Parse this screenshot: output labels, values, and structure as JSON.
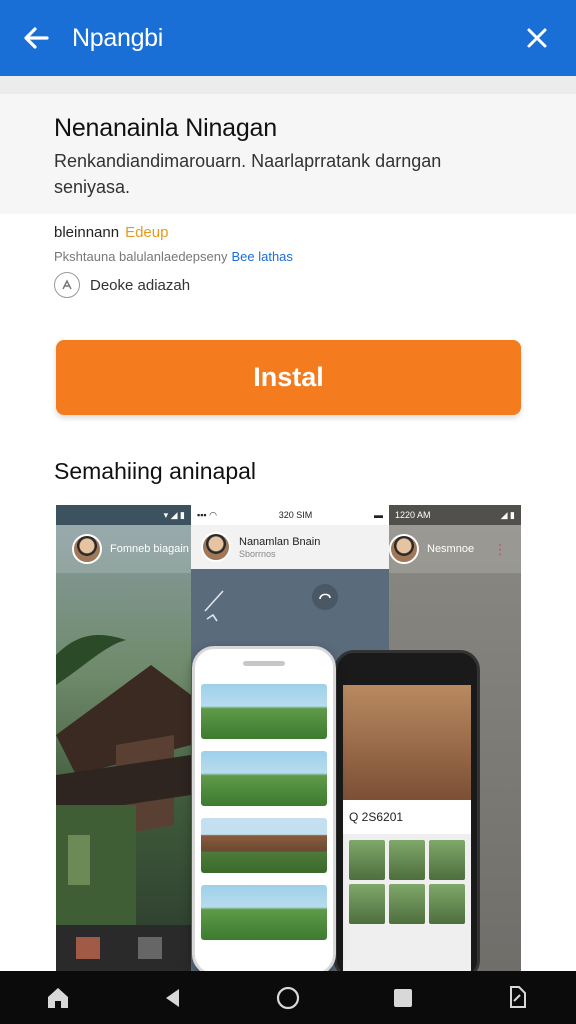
{
  "topbar": {
    "title": "Npangbi",
    "back_icon": "arrow-left-icon",
    "close_icon": "close-icon",
    "color": "#1a6fd6"
  },
  "app": {
    "name": "Nenanainla Ninagan",
    "description": "Renkandiandimarouarn. Naarlaprratank darngan seniyasa.",
    "developer": "bleinnann",
    "developer_tag": "Edeup",
    "meta_text": "Pkshtauna balulanlaedepseny",
    "meta_link": "Bee lathas",
    "rating_text": "Deoke adiazah",
    "rating_icon": "info-circle-icon"
  },
  "install": {
    "label": "Instal",
    "color": "#f47c1e"
  },
  "screenshots": {
    "section_title": "Semahiing aninapal",
    "left_status": "",
    "left_chat_name": "Fomneb biagain",
    "mid_time": "320 SIM",
    "mid_chat_name": "Nanamlan Bnain",
    "mid_chat_sub": "Sborrnos",
    "right_time": "1220 AM",
    "right_chat_name": "Nesmnoe",
    "right_search": "Q 2S6201"
  },
  "navbar": {
    "items": [
      "home-icon",
      "back-triangle-icon",
      "home-circle-icon",
      "recents-square-icon",
      "rotate-icon"
    ]
  }
}
